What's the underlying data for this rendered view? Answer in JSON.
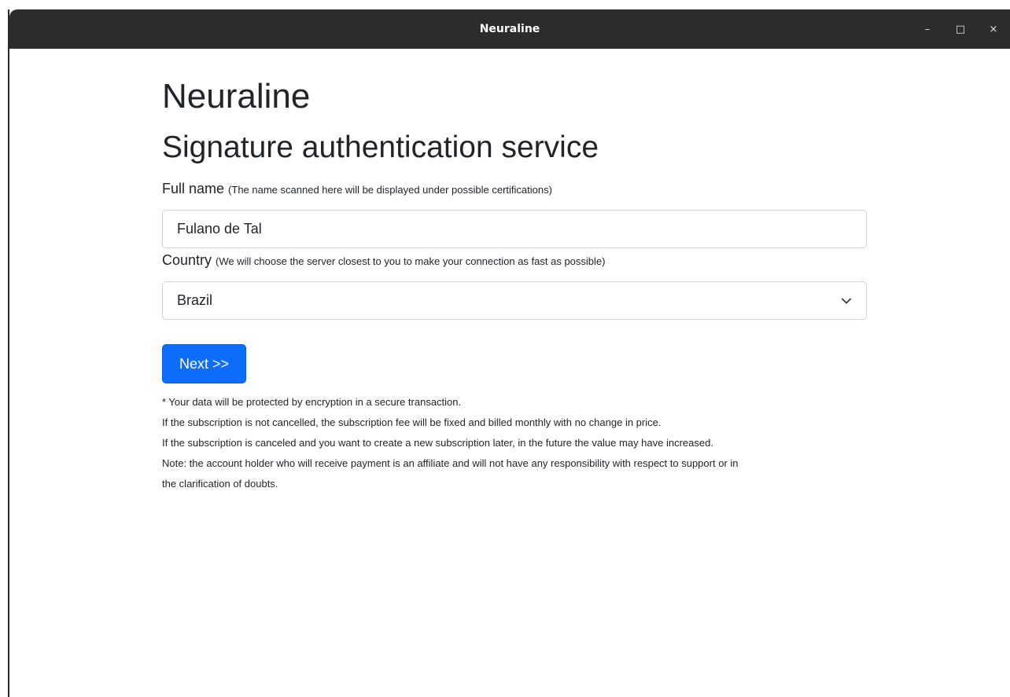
{
  "window": {
    "title": "Neuraline",
    "controls": {
      "minimize": "–",
      "maximize": "□",
      "close": "×"
    }
  },
  "page": {
    "app_name": "Neuraline",
    "subtitle": "Signature authentication service"
  },
  "form": {
    "full_name": {
      "label": "Full name",
      "hint": "(The name scanned here will be displayed under possible certifications)",
      "value": "Fulano de Tal"
    },
    "country": {
      "label": "Country",
      "hint": "(We will choose the server closest to you to make your connection as fast as possible)",
      "selected": "Brazil"
    },
    "next_label": "Next >>"
  },
  "notes": [
    "* Your data will be protected by encryption in a secure transaction.",
    "If the subscription is not cancelled, the subscription fee will be fixed and billed monthly with no change in price.",
    "If the subscription is canceled and you want to create a new subscription later, in the future the value may have increased.",
    "Note: the account holder who will receive payment is an affiliate and will not have any responsibility with respect to support or in",
    "the clarification of doubts."
  ],
  "colors": {
    "titlebar": "#2c2c2c",
    "primary_button": "#0d6efd",
    "input_border": "#ced4da",
    "text": "#212529"
  },
  "icons": {
    "minimize": "minimize-icon",
    "maximize": "maximize-icon",
    "close": "close-icon",
    "select": "chevron-down-icon"
  }
}
